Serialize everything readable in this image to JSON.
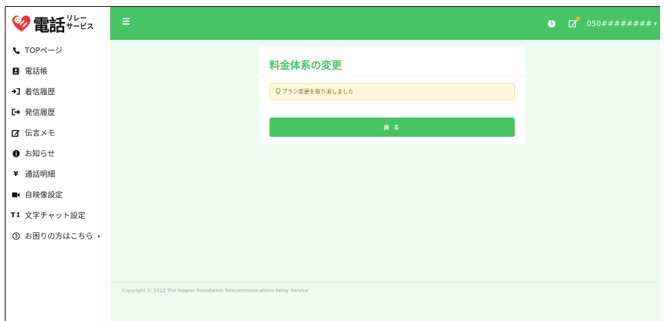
{
  "logo": {
    "main": "電話",
    "sub_top": "リレー",
    "sub_bottom": "サービス"
  },
  "colors": {
    "brand": "#47c466",
    "background": "#eefbef",
    "alert_bg": "#fff8d9"
  },
  "header": {
    "menu_icon": "hamburger-icon",
    "info_icon": "info-icon",
    "memo_icon": "edit-memo-icon",
    "user_number": "050########"
  },
  "sidebar": {
    "items": [
      {
        "label": "TOPページ",
        "icon": "phone-icon"
      },
      {
        "label": "電話帳",
        "icon": "address-book-icon"
      },
      {
        "label": "着信履歴",
        "icon": "incoming-icon"
      },
      {
        "label": "発信履歴",
        "icon": "outgoing-icon"
      },
      {
        "label": "伝言メモ",
        "icon": "memo-icon"
      },
      {
        "label": "お知らせ",
        "icon": "info-icon"
      },
      {
        "label": "通話明細",
        "icon": "yen-icon"
      },
      {
        "label": "自映像設定",
        "icon": "video-icon"
      },
      {
        "label": "文字チャット設定",
        "icon": "text-size-icon"
      },
      {
        "label": "お困りの方はこちら",
        "icon": "help-icon",
        "chevron": "›"
      }
    ]
  },
  "card": {
    "title": "料金体系の変更",
    "alert_text": "プラン変更を取り消しました",
    "button_label": "戻 る"
  },
  "footer": {
    "copyright": "Copyright © 2022 The Nippon Foundation Telecommunications Relay Service"
  }
}
